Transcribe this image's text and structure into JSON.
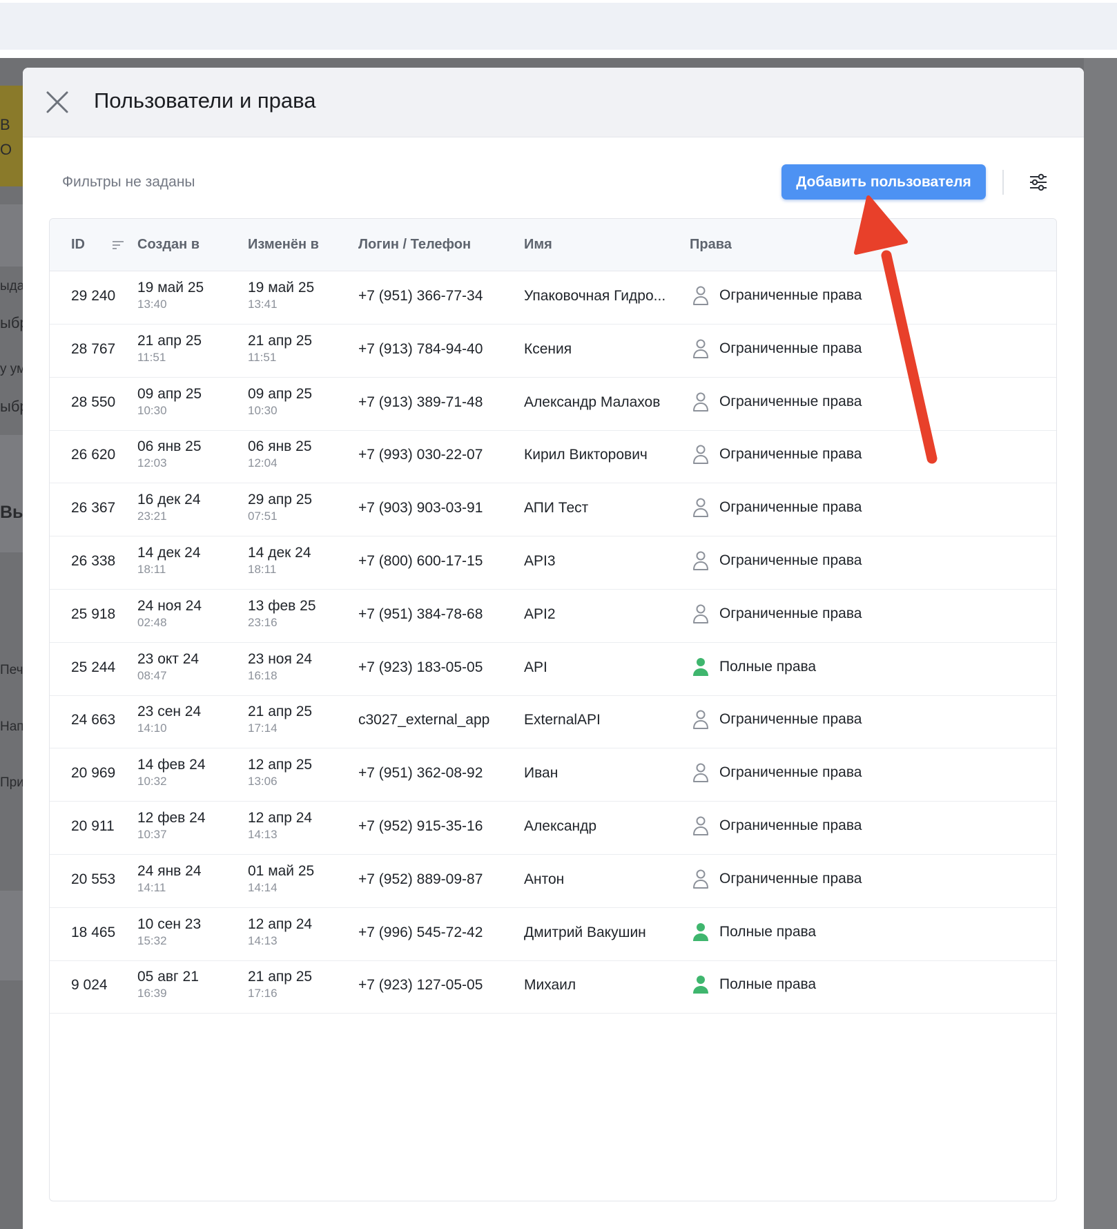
{
  "background": {
    "fragments": [
      "В",
      "О",
      "ыда",
      "ыбр",
      "у ум",
      "ыбр",
      "Вы",
      "Печа",
      "Напи",
      "Прил"
    ]
  },
  "modal": {
    "title": "Пользователи и права",
    "filters_label": "Фильтры не заданы",
    "add_button_label": "Добавить пользователя",
    "columns": {
      "id": "ID",
      "created": "Создан в",
      "modified": "Изменён в",
      "login": "Логин / Телефон",
      "name": "Имя",
      "rights": "Права"
    },
    "rows": [
      {
        "id": "29 240",
        "created_date": "19 май 25",
        "created_time": "13:40",
        "modified_date": "19 май 25",
        "modified_time": "13:41",
        "login": "+7 (951) 366-77-34",
        "name": "Упаковочная Гидро...",
        "rights": "Ограниченные права",
        "full": false
      },
      {
        "id": "28 767",
        "created_date": "21 апр 25",
        "created_time": "11:51",
        "modified_date": "21 апр 25",
        "modified_time": "11:51",
        "login": "+7 (913) 784-94-40",
        "name": "Ксения",
        "rights": "Ограниченные права",
        "full": false
      },
      {
        "id": "28 550",
        "created_date": "09 апр 25",
        "created_time": "10:30",
        "modified_date": "09 апр 25",
        "modified_time": "10:30",
        "login": "+7 (913) 389-71-48",
        "name": "Александр Малахов",
        "rights": "Ограниченные права",
        "full": false
      },
      {
        "id": "26 620",
        "created_date": "06 янв 25",
        "created_time": "12:03",
        "modified_date": "06 янв 25",
        "modified_time": "12:04",
        "login": "+7 (993) 030-22-07",
        "name": "Кирил Викторович",
        "rights": "Ограниченные права",
        "full": false
      },
      {
        "id": "26 367",
        "created_date": "16 дек 24",
        "created_time": "23:21",
        "modified_date": "29 апр 25",
        "modified_time": "07:51",
        "login": "+7 (903) 903-03-91",
        "name": "АПИ Тест",
        "rights": "Ограниченные права",
        "full": false
      },
      {
        "id": "26 338",
        "created_date": "14 дек 24",
        "created_time": "18:11",
        "modified_date": "14 дек 24",
        "modified_time": "18:11",
        "login": "+7 (800) 600-17-15",
        "name": "API3",
        "rights": "Ограниченные права",
        "full": false
      },
      {
        "id": "25 918",
        "created_date": "24 ноя 24",
        "created_time": "02:48",
        "modified_date": "13 фев 25",
        "modified_time": "23:16",
        "login": "+7 (951) 384-78-68",
        "name": "API2",
        "rights": "Ограниченные права",
        "full": false
      },
      {
        "id": "25 244",
        "created_date": "23 окт 24",
        "created_time": "08:47",
        "modified_date": "23 ноя 24",
        "modified_time": "16:18",
        "login": "+7 (923) 183-05-05",
        "name": "API",
        "rights": "Полные права",
        "full": true
      },
      {
        "id": "24 663",
        "created_date": "23 сен 24",
        "created_time": "14:10",
        "modified_date": "21 апр 25",
        "modified_time": "17:14",
        "login": "c3027_external_app",
        "name": "ExternalAPI",
        "rights": "Ограниченные права",
        "full": false
      },
      {
        "id": "20 969",
        "created_date": "14 фев 24",
        "created_time": "10:32",
        "modified_date": "12 апр 25",
        "modified_time": "13:06",
        "login": "+7 (951) 362-08-92",
        "name": "Иван",
        "rights": "Ограниченные права",
        "full": false
      },
      {
        "id": "20 911",
        "created_date": "12 фев 24",
        "created_time": "10:37",
        "modified_date": "12 апр 24",
        "modified_time": "14:13",
        "login": "+7 (952) 915-35-16",
        "name": "Александр",
        "rights": "Ограниченные права",
        "full": false
      },
      {
        "id": "20 553",
        "created_date": "24 янв 24",
        "created_time": "14:11",
        "modified_date": "01 май 25",
        "modified_time": "14:14",
        "login": "+7 (952) 889-09-87",
        "name": "Антон",
        "rights": "Ограниченные права",
        "full": false
      },
      {
        "id": "18 465",
        "created_date": "10 сен 23",
        "created_time": "15:32",
        "modified_date": "12 апр 24",
        "modified_time": "14:13",
        "login": "+7 (996) 545-72-42",
        "name": "Дмитрий Вакушин",
        "rights": "Полные права",
        "full": true
      },
      {
        "id": "9 024",
        "created_date": "05 авг 21",
        "created_time": "16:39",
        "modified_date": "21 апр 25",
        "modified_time": "17:16",
        "login": "+7 (923) 127-05-05",
        "name": "Михаил",
        "rights": "Полные права",
        "full": true
      }
    ]
  },
  "colors": {
    "primary_button": "#4d92f3",
    "full_rights_icon": "#3fb66e",
    "limited_rights_icon": "#8c919a",
    "annotation_arrow": "#e8402a"
  },
  "icons": {
    "close": "close-icon",
    "sort": "sort-icon",
    "settings": "filter-settings-icon",
    "user_outline": "user-outline-icon",
    "user_filled": "user-filled-icon"
  }
}
